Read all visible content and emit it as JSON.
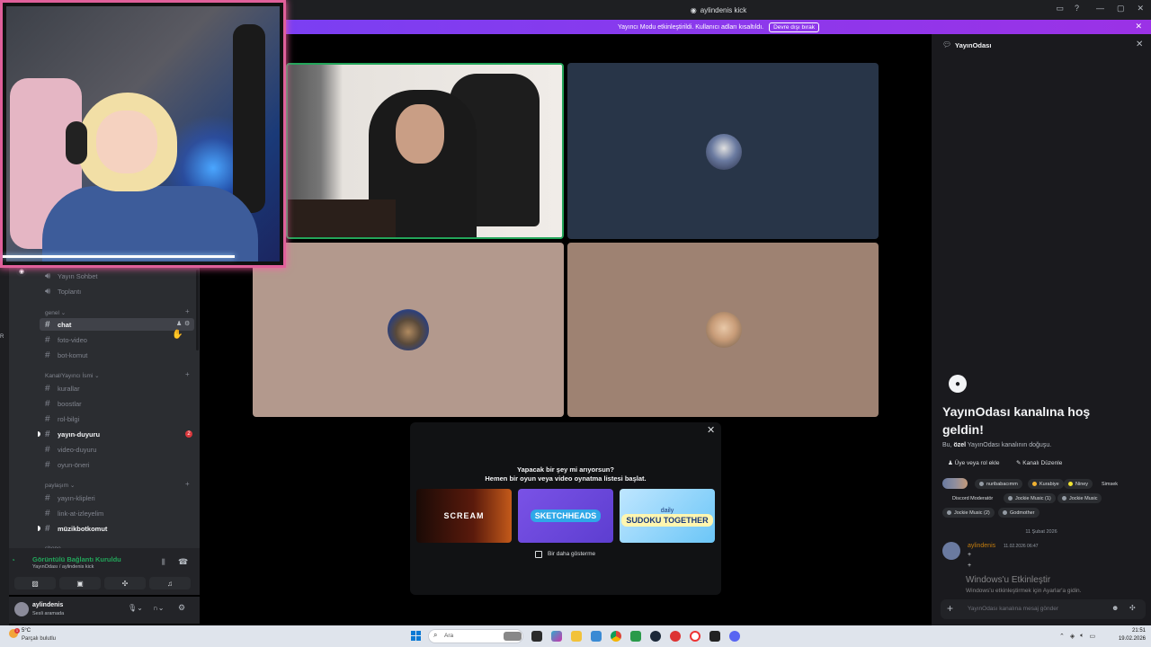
{
  "window": {
    "title": "aylindenis kick",
    "title_icon": "discord-icon"
  },
  "banner": {
    "text": "Yayıncı Modu etkinleştirildi. Kullanıcı adları kısaltıldı.",
    "button": "Devre dışı bırak",
    "close": "✕"
  },
  "sidebar": {
    "rail_fragment": "R",
    "voice_channels": [
      {
        "label": "Yayın Sohbet"
      },
      {
        "label": "Toplantı"
      }
    ],
    "categories": [
      {
        "label": "genel"
      },
      {
        "label": "Kanal/Yayıncı İsmi"
      },
      {
        "label": "paylaşım"
      },
      {
        "label": "shope"
      }
    ],
    "channels": {
      "chat": "chat",
      "foto_video": "foto-video",
      "bot_komut": "bot-komut",
      "kurallar": "kurallar",
      "boostlar": "boostlar",
      "rol_bilgi": "rol-bilgi",
      "yayin_duyuru": "yayın-duyuru",
      "video_duyuru": "video-duyuru",
      "oyun_oneri": "oyun-öneri",
      "yayin_klipleri": "yayın-klipleri",
      "link_at": "link-at-izleyelim",
      "muzikbot": "müzikbotkomut"
    },
    "mention_count": "2"
  },
  "voice_panel": {
    "status": "Görüntülü Bağlantı Kuruldu",
    "channel": "YayınOdası / aylindenis kick"
  },
  "user": {
    "name": "aylindenis",
    "status": "Sesli aramada"
  },
  "popup": {
    "title_line1": "Yapacak bir şey mi arıyorsun?",
    "title_line2": "Hemen bir oyun veya video oynatma listesi başlat.",
    "games": [
      "SCREAM",
      "SKETCHHEADS",
      "SUDOKU TOGETHER"
    ],
    "game3_top": "daily",
    "checkbox_label": "Bir daha gösterme"
  },
  "right_panel": {
    "title": "YayınOdası",
    "welcome": "YayınOdası kanalına hoş geldin!",
    "desc_prefix": "Bu, ",
    "desc_bold": "özel",
    "desc_suffix": " YayınOdası kanalının doğuşu.",
    "action_add": "Üye veya rol ekle",
    "action_edit": "Kanalı Düzenle",
    "roles": [
      {
        "label": "nuribabacımm",
        "color": "#949ba4"
      },
      {
        "label": "Kurabiye",
        "color": "#f0b232"
      },
      {
        "label": "Niney",
        "color": "#f0e332"
      },
      {
        "label": "Simsek",
        "color": ""
      },
      {
        "label": "Discord Moderatör",
        "color": ""
      },
      {
        "label": "Jockie Music (1)",
        "color": "#949ba4"
      },
      {
        "label": "Jockie Music",
        "color": "#949ba4"
      },
      {
        "label": "Jockie Music (2)",
        "color": "#949ba4"
      },
      {
        "label": "Godmother",
        "color": "#949ba4"
      }
    ],
    "date_divider": "11 Şubat 2026",
    "message": {
      "author": "aylindenis",
      "time": "11.02.2026 06:47",
      "line1": "+",
      "line2": "+"
    },
    "watermark_title": "Windows'u Etkinleştir",
    "watermark_sub": "Windows'u etkinleştirmek için Ayarlar'a gidin.",
    "input_placeholder": "YayınOdası kanalına mesaj gönder"
  },
  "taskbar": {
    "weather_temp": "5°C",
    "weather_desc": "Parçalı bulutlu",
    "weather_badge": "1",
    "search_placeholder": "Ara",
    "time": "21:51",
    "date": "19.02.2026"
  }
}
